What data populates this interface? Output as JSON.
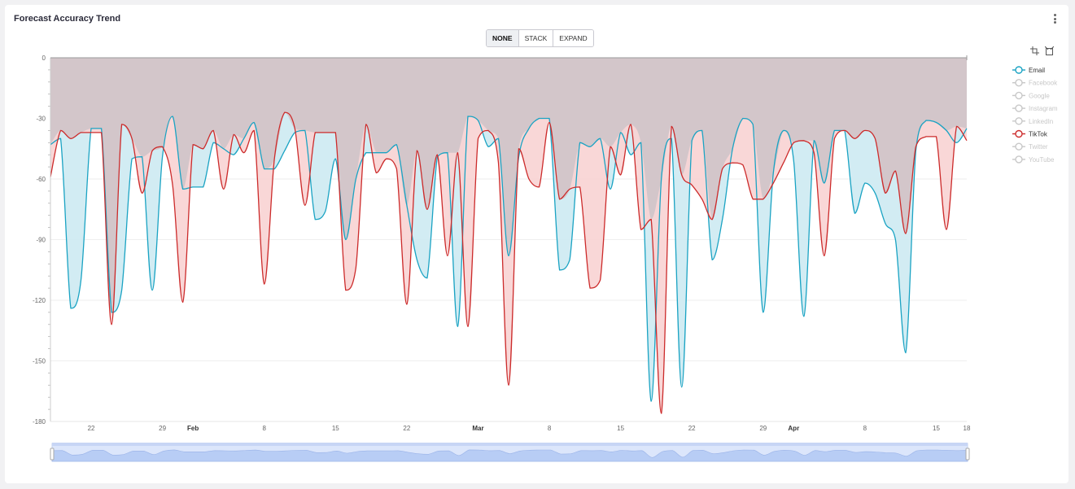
{
  "widget": {
    "title": "Forecast Accuracy Trend",
    "menu_icon": "kebab-menu-icon"
  },
  "stack_modes": [
    {
      "label": "NONE",
      "active": true
    },
    {
      "label": "STACK",
      "active": false
    },
    {
      "label": "EXPAND",
      "active": false
    }
  ],
  "toolbar": {
    "icons": [
      "zoom-select-icon",
      "zoom-reset-icon"
    ]
  },
  "chart_data": {
    "type": "area",
    "title": "Forecast Accuracy Trend",
    "xlabel": "",
    "ylabel": "",
    "ylim": [
      -180,
      0
    ],
    "y_ticks": [
      "0",
      "-30",
      "-60",
      "-90",
      "-120",
      "-150",
      "-180"
    ],
    "x_range": [
      "2025-01-18",
      "2025-04-18"
    ],
    "x_ticks": [
      {
        "date": "2025-01-22",
        "label": "22",
        "major": false
      },
      {
        "date": "2025-01-29",
        "label": "29",
        "major": false
      },
      {
        "date": "2025-02-01",
        "label": "Feb",
        "major": true
      },
      {
        "date": "2025-02-08",
        "label": "8",
        "major": false
      },
      {
        "date": "2025-02-15",
        "label": "15",
        "major": false
      },
      {
        "date": "2025-02-22",
        "label": "22",
        "major": false
      },
      {
        "date": "2025-03-01",
        "label": "Mar",
        "major": true
      },
      {
        "date": "2025-03-08",
        "label": "8",
        "major": false
      },
      {
        "date": "2025-03-15",
        "label": "15",
        "major": false
      },
      {
        "date": "2025-03-22",
        "label": "22",
        "major": false
      },
      {
        "date": "2025-03-29",
        "label": "29",
        "major": false
      },
      {
        "date": "2025-04-01",
        "label": "Apr",
        "major": true
      },
      {
        "date": "2025-04-08",
        "label": "8",
        "major": false
      },
      {
        "date": "2025-04-15",
        "label": "15",
        "major": false
      },
      {
        "date": "2025-04-18",
        "label": "18",
        "major": false
      }
    ],
    "legend_position": "right",
    "grid": true,
    "series": [
      {
        "name": "Email",
        "color": "#1aa3c3",
        "fill": "#cdeaf2",
        "visible": true,
        "x": [
          "2025-01-18",
          "2025-01-19",
          "2025-01-20",
          "2025-01-21",
          "2025-01-22",
          "2025-01-23",
          "2025-01-24",
          "2025-01-25",
          "2025-01-26",
          "2025-01-27",
          "2025-01-28",
          "2025-01-29",
          "2025-01-30",
          "2025-01-31",
          "2025-02-01",
          "2025-02-02",
          "2025-02-03",
          "2025-02-04",
          "2025-02-05",
          "2025-02-06",
          "2025-02-07",
          "2025-02-08",
          "2025-02-09",
          "2025-02-10",
          "2025-02-11",
          "2025-02-12",
          "2025-02-13",
          "2025-02-14",
          "2025-02-15",
          "2025-02-16",
          "2025-02-17",
          "2025-02-18",
          "2025-02-19",
          "2025-02-20",
          "2025-02-21",
          "2025-02-22",
          "2025-02-23",
          "2025-02-24",
          "2025-02-25",
          "2025-02-26",
          "2025-02-27",
          "2025-02-28",
          "2025-03-01",
          "2025-03-02",
          "2025-03-03",
          "2025-03-04",
          "2025-03-05",
          "2025-03-06",
          "2025-03-07",
          "2025-03-08",
          "2025-03-09",
          "2025-03-10",
          "2025-03-11",
          "2025-03-12",
          "2025-03-13",
          "2025-03-14",
          "2025-03-15",
          "2025-03-16",
          "2025-03-17",
          "2025-03-18",
          "2025-03-19",
          "2025-03-20",
          "2025-03-21",
          "2025-03-22",
          "2025-03-23",
          "2025-03-24",
          "2025-03-25",
          "2025-03-26",
          "2025-03-27",
          "2025-03-28",
          "2025-03-29",
          "2025-03-30",
          "2025-03-31",
          "2025-04-01",
          "2025-04-02",
          "2025-04-03",
          "2025-04-04",
          "2025-04-05",
          "2025-04-06",
          "2025-04-07",
          "2025-04-08",
          "2025-04-09",
          "2025-04-10",
          "2025-04-11",
          "2025-04-12",
          "2025-04-13",
          "2025-04-14",
          "2025-04-15",
          "2025-04-16",
          "2025-04-17",
          "2025-04-18"
        ],
        "values": [
          -43,
          -40,
          -124,
          -110,
          -35,
          -35,
          -126,
          -115,
          -50,
          -49,
          -115,
          -49,
          -29,
          -65,
          -64,
          -64,
          -42,
          -45,
          -48,
          -40,
          -32,
          -55,
          -55,
          -46,
          -37,
          -36,
          -80,
          -76,
          -50,
          -90,
          -60,
          -47,
          -47,
          -47,
          -43,
          -73,
          -100,
          -109,
          -49,
          -47,
          -133,
          -29,
          -31,
          -44,
          -40,
          -98,
          -49,
          -35,
          -30,
          -30,
          -105,
          -100,
          -42,
          -44,
          -40,
          -65,
          -37,
          -48,
          -42,
          -170,
          -60,
          -40,
          -163,
          -41,
          -36,
          -100,
          -80,
          -45,
          -30,
          -33,
          -126,
          -57,
          -36,
          -51,
          -128,
          -41,
          -62,
          -36,
          -36,
          -77,
          -62,
          -67,
          -82,
          -90,
          -146,
          -46,
          -31,
          -32,
          -36,
          -42,
          -35
        ]
      },
      {
        "name": "Facebook",
        "color": "#c8c8c8",
        "visible": false
      },
      {
        "name": "Google",
        "color": "#c8c8c8",
        "visible": false
      },
      {
        "name": "Instagram",
        "color": "#c8c8c8",
        "visible": false
      },
      {
        "name": "LinkedIn",
        "color": "#c8c8c8",
        "visible": false
      },
      {
        "name": "TikTok",
        "color": "#cc2b2b",
        "fill": "#f8d3d3",
        "visible": true,
        "x": [
          "2025-01-18",
          "2025-01-19",
          "2025-01-20",
          "2025-01-21",
          "2025-01-22",
          "2025-01-23",
          "2025-01-24",
          "2025-01-25",
          "2025-01-26",
          "2025-01-27",
          "2025-01-28",
          "2025-01-29",
          "2025-01-30",
          "2025-01-31",
          "2025-02-01",
          "2025-02-02",
          "2025-02-03",
          "2025-02-04",
          "2025-02-05",
          "2025-02-06",
          "2025-02-07",
          "2025-02-08",
          "2025-02-09",
          "2025-02-10",
          "2025-02-11",
          "2025-02-12",
          "2025-02-13",
          "2025-02-14",
          "2025-02-15",
          "2025-02-16",
          "2025-02-17",
          "2025-02-18",
          "2025-02-19",
          "2025-02-20",
          "2025-02-21",
          "2025-02-22",
          "2025-02-23",
          "2025-02-24",
          "2025-02-25",
          "2025-02-26",
          "2025-02-27",
          "2025-02-28",
          "2025-03-01",
          "2025-03-02",
          "2025-03-03",
          "2025-03-04",
          "2025-03-05",
          "2025-03-06",
          "2025-03-07",
          "2025-03-08",
          "2025-03-09",
          "2025-03-10",
          "2025-03-11",
          "2025-03-12",
          "2025-03-13",
          "2025-03-14",
          "2025-03-15",
          "2025-03-16",
          "2025-03-17",
          "2025-03-18",
          "2025-03-19",
          "2025-03-20",
          "2025-03-21",
          "2025-03-22",
          "2025-03-23",
          "2025-03-24",
          "2025-03-25",
          "2025-03-26",
          "2025-03-27",
          "2025-03-28",
          "2025-03-29",
          "2025-03-30",
          "2025-03-31",
          "2025-04-01",
          "2025-04-02",
          "2025-04-03",
          "2025-04-04",
          "2025-04-05",
          "2025-04-06",
          "2025-04-07",
          "2025-04-08",
          "2025-04-09",
          "2025-04-10",
          "2025-04-11",
          "2025-04-12",
          "2025-04-13",
          "2025-04-14",
          "2025-04-15",
          "2025-04-16",
          "2025-04-17",
          "2025-04-18"
        ],
        "values": [
          -59,
          -36,
          -40,
          -37,
          -37,
          -37,
          -132,
          -33,
          -40,
          -67,
          -46,
          -44,
          -63,
          -121,
          -43,
          -45,
          -36,
          -65,
          -38,
          -47,
          -36,
          -112,
          -50,
          -27,
          -35,
          -73,
          -37,
          -37,
          -37,
          -115,
          -104,
          -33,
          -57,
          -50,
          -55,
          -122,
          -46,
          -75,
          -48,
          -98,
          -47,
          -133,
          -40,
          -36,
          -52,
          -162,
          -45,
          -60,
          -64,
          -32,
          -70,
          -65,
          -64,
          -114,
          -110,
          -44,
          -58,
          -33,
          -85,
          -80,
          -176,
          -34,
          -58,
          -63,
          -70,
          -80,
          -55,
          -52,
          -53,
          -70,
          -70,
          -62,
          -52,
          -42,
          -41,
          -47,
          -98,
          -40,
          -36,
          -40,
          -36,
          -40,
          -67,
          -56,
          -87,
          -44,
          -39,
          -39,
          -85,
          -34,
          -41
        ]
      },
      {
        "name": "Twitter",
        "color": "#c8c8c8",
        "visible": false
      },
      {
        "name": "YouTube",
        "color": "#c8c8c8",
        "visible": false
      }
    ]
  }
}
